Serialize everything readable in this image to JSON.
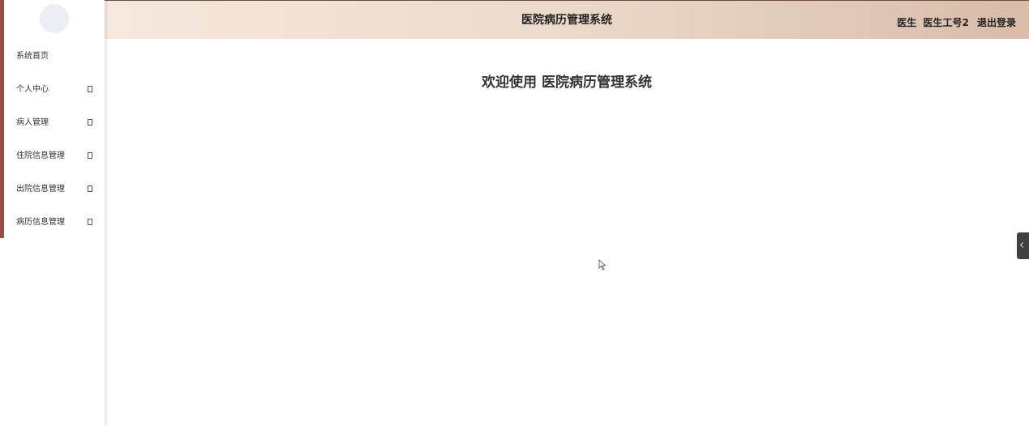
{
  "header": {
    "title": "医院病历管理系统",
    "role": "医生",
    "username": "医生工号2",
    "logout_label": "退出登录"
  },
  "sidebar": {
    "items": [
      {
        "label": "系统首页",
        "has_submenu": false
      },
      {
        "label": "个人中心",
        "has_submenu": true
      },
      {
        "label": "病人管理",
        "has_submenu": true
      },
      {
        "label": "住院信息管理",
        "has_submenu": true
      },
      {
        "label": "出院信息管理",
        "has_submenu": true
      },
      {
        "label": "病历信息管理",
        "has_submenu": true
      }
    ]
  },
  "main": {
    "welcome": "欢迎使用 医院病历管理系统"
  },
  "colors": {
    "sidebar_accent": "#9a4e43",
    "header_gradient_start": "#f6e8dd",
    "header_gradient_end": "#d9bcaa",
    "toggle": "#404040"
  }
}
